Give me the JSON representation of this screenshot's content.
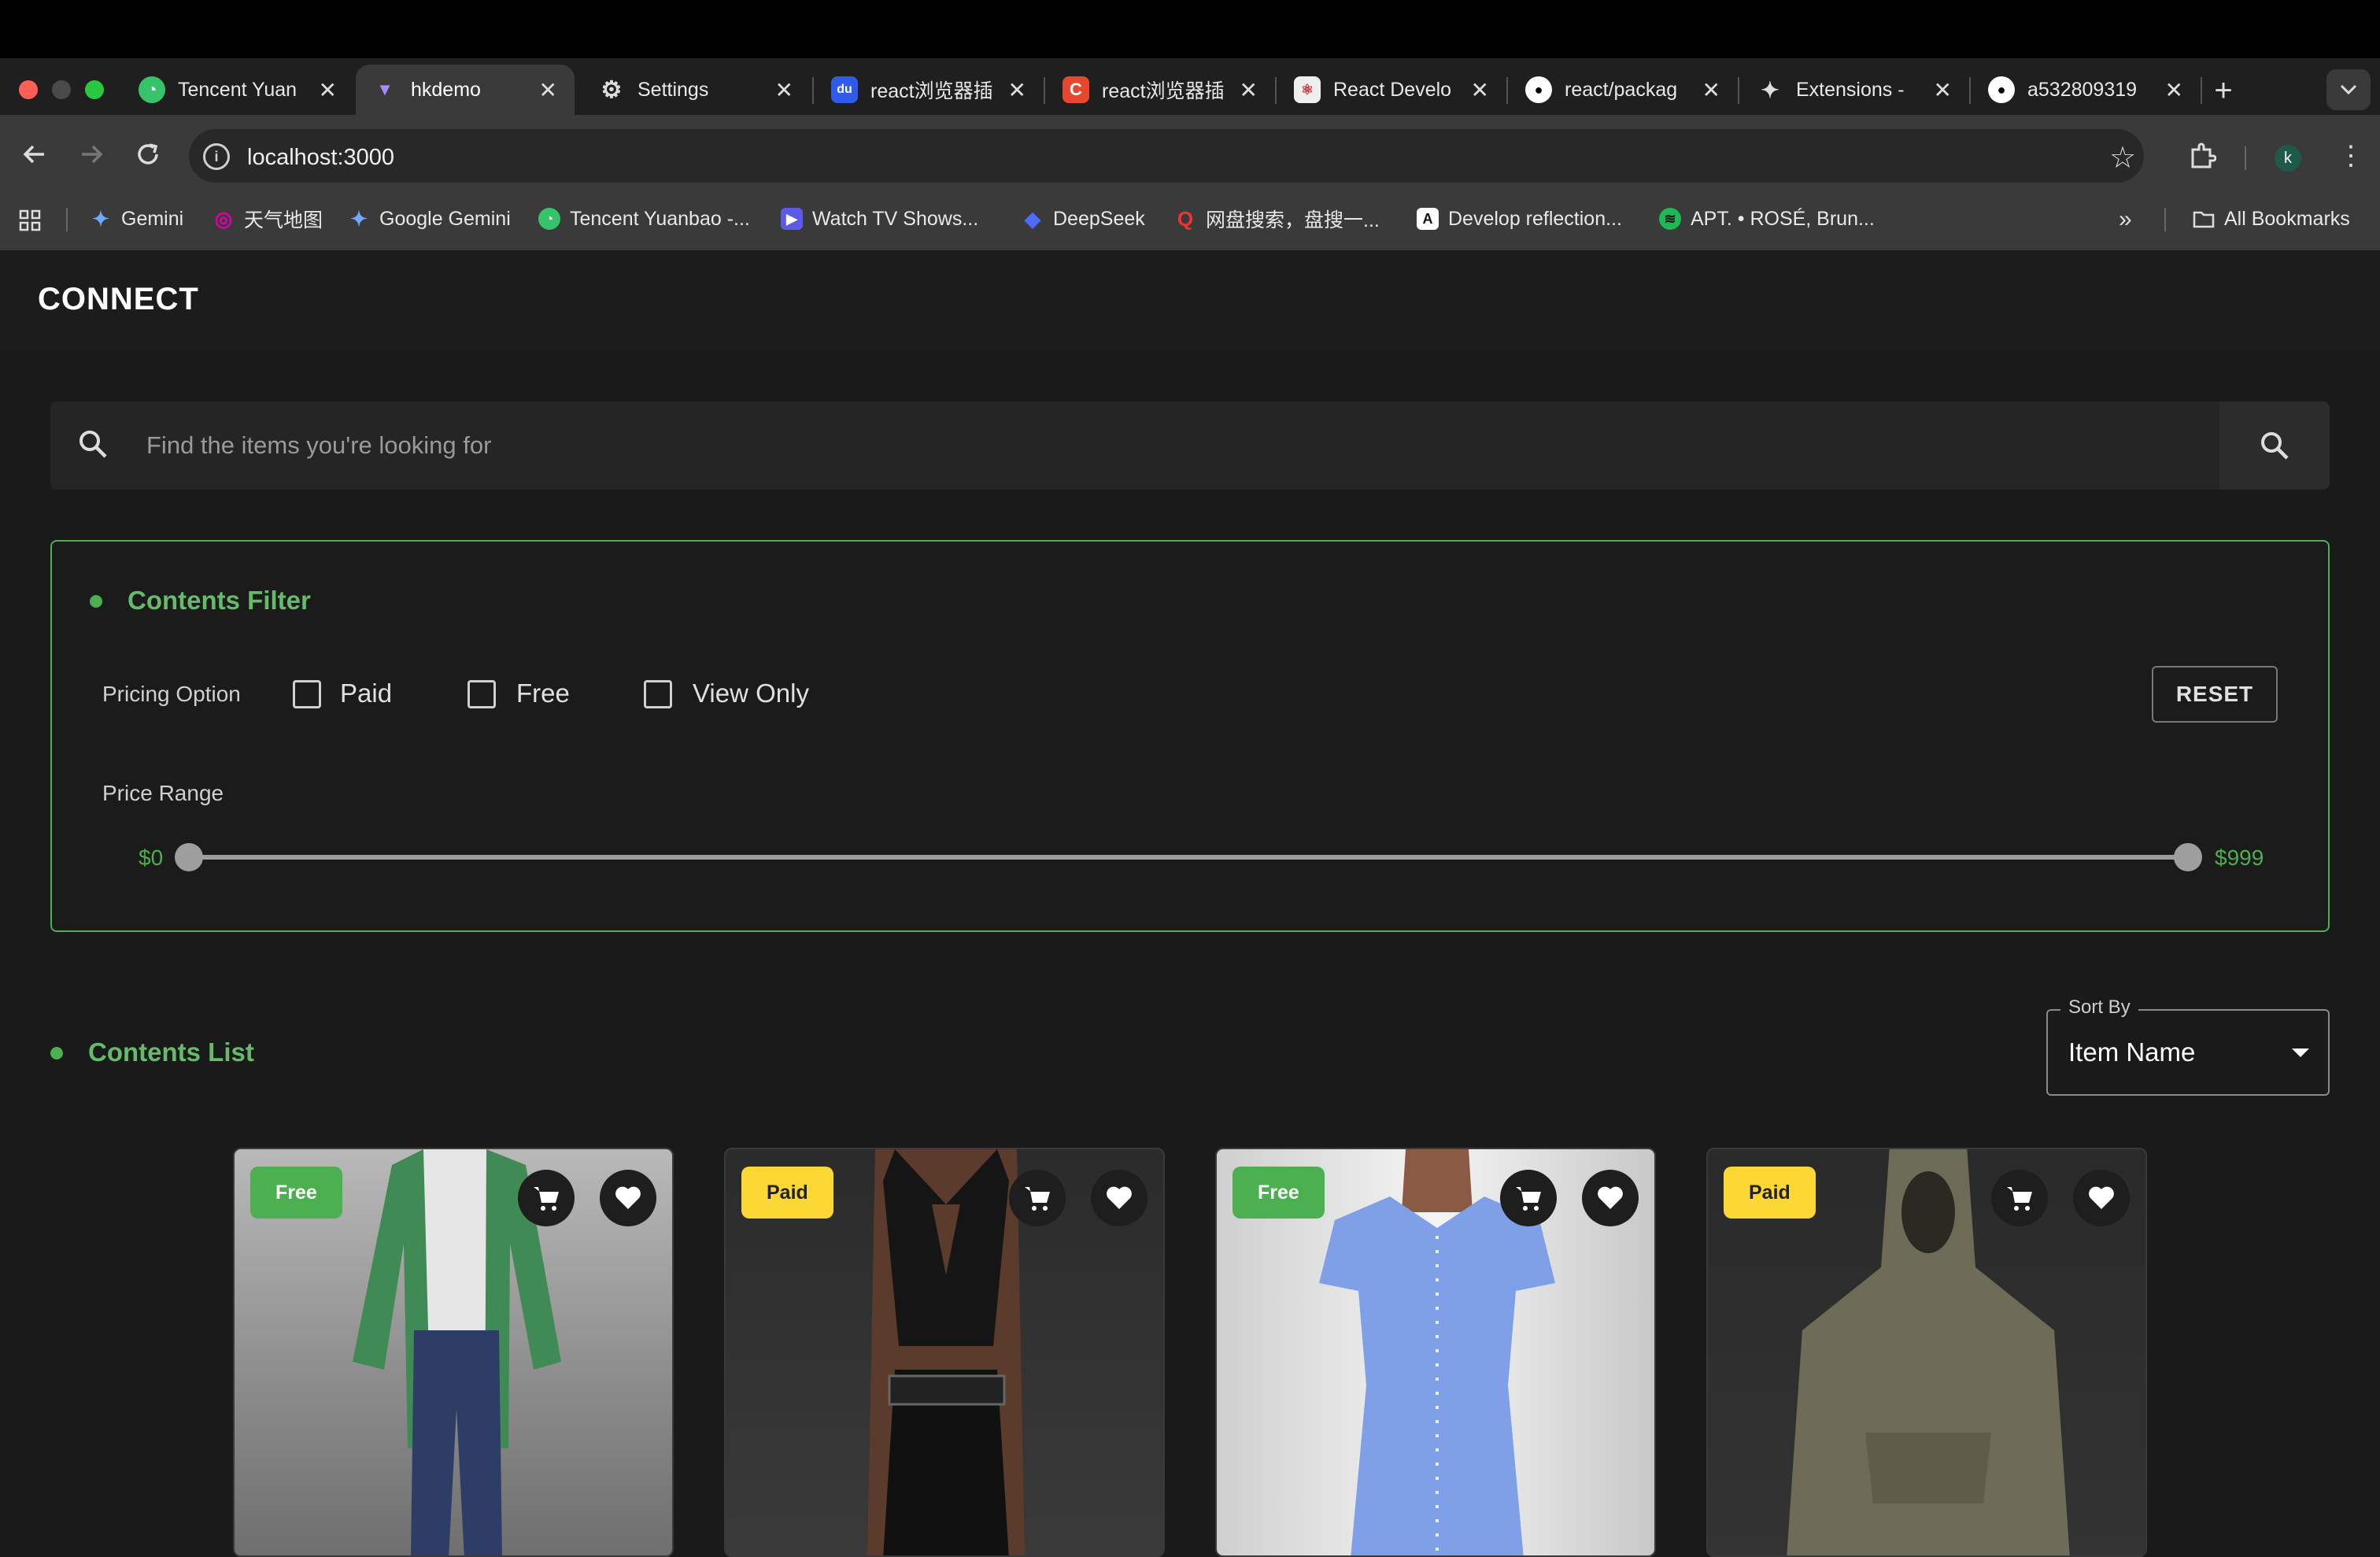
{
  "browser": {
    "tabs": [
      {
        "label": "Tencent Yuan",
        "icon": "tencent-yuanbao-icon",
        "active": false
      },
      {
        "label": "hkdemo",
        "icon": "vite-icon",
        "active": true
      },
      {
        "label": "Settings",
        "icon": "gear-icon",
        "active": false
      },
      {
        "label": "react浏览器插",
        "icon": "baidu-icon",
        "active": false
      },
      {
        "label": "react浏览器插",
        "icon": "csdn-icon",
        "active": false
      },
      {
        "label": "React Develo",
        "icon": "react-devtools-icon",
        "active": false
      },
      {
        "label": "react/packag",
        "icon": "github-icon",
        "active": false
      },
      {
        "label": "Extensions -",
        "icon": "puzzle-icon",
        "active": false
      },
      {
        "label": "a532809319",
        "icon": "github-icon",
        "active": false
      }
    ],
    "url": "localhost:3000",
    "profile_initial": "k",
    "bookmarks": [
      {
        "label": "Gemini",
        "icon": "gemini-icon"
      },
      {
        "label": "天气地图",
        "icon": "weather-icon"
      },
      {
        "label": "Google Gemini",
        "icon": "gemini-icon"
      },
      {
        "label": "Tencent Yuanbao -...",
        "icon": "tencent-yuanbao-icon"
      },
      {
        "label": "Watch TV Shows...",
        "icon": "play-icon"
      },
      {
        "label": "DeepSeek",
        "icon": "deepseek-icon"
      },
      {
        "label": "网盘搜索，盘搜一...",
        "icon": "search-q-icon"
      },
      {
        "label": "Develop reflection...",
        "icon": "anthropic-icon"
      },
      {
        "label": "APT. • ROSÉ, Brun...",
        "icon": "spotify-icon"
      }
    ],
    "all_bookmarks": "All Bookmarks"
  },
  "app": {
    "brand": "CONNECT",
    "search": {
      "placeholder": "Find the items you're looking for"
    },
    "filter": {
      "title": "Contents Filter",
      "pricing_label": "Pricing Option",
      "options": [
        {
          "label": "Paid",
          "checked": false
        },
        {
          "label": "Free",
          "checked": false
        },
        {
          "label": "View Only",
          "checked": false
        }
      ],
      "reset_label": "RESET",
      "price_range_label": "Price Range",
      "price_min": "$0",
      "price_max": "$999"
    },
    "list": {
      "title": "Contents List",
      "sort_legend": "Sort By",
      "sort_value": "Item Name"
    },
    "items": [
      {
        "badge": "Free",
        "type": "free",
        "item": "green-cardigan-jeans-outfit"
      },
      {
        "badge": "Paid",
        "type": "paid",
        "item": "black-leather-halter-top-skirt"
      },
      {
        "badge": "Free",
        "type": "free",
        "item": "blue-puff-sleeve-dress"
      },
      {
        "badge": "Paid",
        "type": "paid",
        "item": "olive-hooded-anorak"
      }
    ]
  },
  "colors": {
    "accent_green": "#4caf50",
    "paid_yellow": "#fdd835",
    "background": "#1a1a1a"
  }
}
